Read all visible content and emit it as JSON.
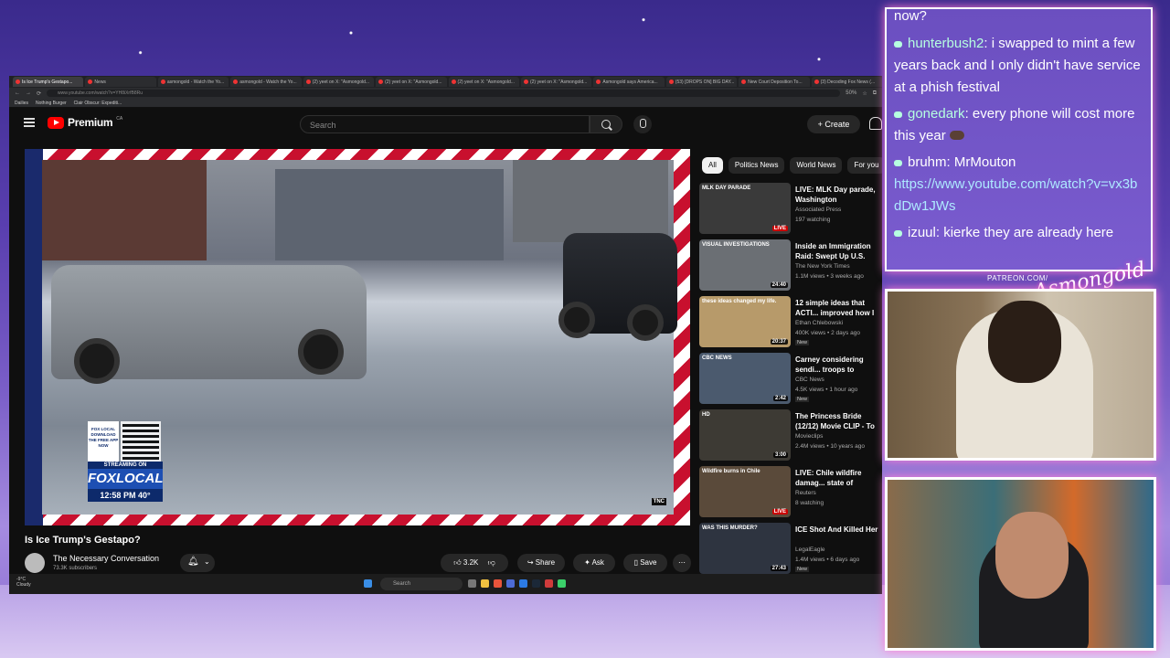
{
  "browser": {
    "tabs": [
      {
        "label": "Is Ice Trump's Gestapo...",
        "active": true
      },
      {
        "label": "News",
        "active": false
      },
      {
        "label": "asmongold - Watch the Yo...",
        "active": false
      },
      {
        "label": "asmongold - Watch the Yo...",
        "active": false
      },
      {
        "label": "(2) yeet on X: \"Asmongold...",
        "active": false
      },
      {
        "label": "(2) yeet on X: \"Asmongold...",
        "active": false
      },
      {
        "label": "(2) yeet on X: \"Asmongold...",
        "active": false
      },
      {
        "label": "(2) yeet on X: \"Asmongold...",
        "active": false
      },
      {
        "label": "Asmongold says America...",
        "active": false
      },
      {
        "label": "(53) [DROPS ON] BIG DAY...",
        "active": false
      },
      {
        "label": "New Court Deposition To...",
        "active": false
      },
      {
        "label": "(3) Decoding Fox News (...",
        "active": false
      }
    ],
    "url": "www.youtube.com/watch?v=YH8iXrfB8Ru",
    "zoom": "50%",
    "bookmarks": [
      "Dailies",
      "Nothing Burger",
      "Clair Obscur: Expediti..."
    ]
  },
  "youtube": {
    "logo_text": "Premium",
    "logo_region": "CA",
    "search_placeholder": "Search",
    "create_label": "Create",
    "video": {
      "title": "Is Ice Trump's Gestapo?",
      "channel": "The Necessary Conversation",
      "subscribers": "73.3K subscribers",
      "likes": "3.2K",
      "share_label": "Share",
      "ask_label": "Ask",
      "save_label": "Save",
      "overlay": {
        "fox_top": "FOX LOCAL DOWNLOAD THE FREE APP NOW",
        "streaming": "STREAMING ON",
        "brand": "FOXLOCAL",
        "time_temp": "12:58 PM  40°",
        "watermark": "TNC"
      }
    },
    "chips": [
      "All",
      "Politics News",
      "World News",
      "For you"
    ],
    "recommendations": [
      {
        "title": "LIVE: MLK Day parade, Washington",
        "channel": "Associated Press",
        "meta": "197 watching",
        "badge": "LIVE",
        "thumb_text": "MLK DAY PARADE",
        "thumb_color": "#3a3a3a"
      },
      {
        "title": "Inside an Immigration Raid: Swept Up U.S. Citizens | V...",
        "channel": "The New York Times",
        "meta": "1.1M views • 3 weeks ago",
        "badge": "24:40",
        "thumb_text": "VISUAL INVESTIGATIONS",
        "thumb_color": "#6b6f74"
      },
      {
        "title": "12 simple ideas that ACTI... improved how I cook.",
        "channel": "Ethan Chlebowski",
        "meta": "400K views • 2 days ago",
        "badge": "20:37",
        "thumb_text": "these ideas changed my life.",
        "thumb_color": "#b79a6a",
        "new": "New"
      },
      {
        "title": "Carney considering sendi... troops to Greenland for N...",
        "channel": "CBC News",
        "meta": "4.5K views • 1 hour ago",
        "badge": "2:42",
        "thumb_text": "CBC NEWS",
        "thumb_color": "#4b5a6e",
        "new": "New"
      },
      {
        "title": "The Princess Bride (12/12) Movie CLIP - To the Pain!",
        "channel": "Movieclips",
        "meta": "2.4M views • 10 years ago",
        "badge": "3:00",
        "thumb_text": "HD",
        "thumb_color": "#3d3a34"
      },
      {
        "title": "LIVE: Chile wildfire damag... state of catastrophe is de...",
        "channel": "Reuters",
        "meta": "8 watching",
        "badge": "LIVE",
        "thumb_text": "Wildfire burns in Chile",
        "thumb_color": "#5a4a3a"
      },
      {
        "title": "ICE Shot And Killed Her",
        "channel": "LegalEagle",
        "meta": "1.4M views • 6 days ago",
        "badge": "27:43",
        "thumb_text": "WAS THIS MURDER?",
        "thumb_color": "#2e3440",
        "new": "New"
      }
    ]
  },
  "taskbar": {
    "weather_temp": "-9°C",
    "weather_desc": "Cloudy",
    "search_label": "Search"
  },
  "chat": {
    "top_partial": "now?",
    "messages": [
      {
        "user": "hunterbush2",
        "text": "i swapped to mint a few years back and I only didn't have service at a phish festival"
      },
      {
        "user": "gonedark",
        "text": "every phone will cost more this year"
      },
      {
        "user": "bruhm",
        "text": "MrMouton",
        "link": "https://www.youtube.com/watch?v=vx3bdDw1JWs"
      },
      {
        "user": "izuul",
        "text": "kierke they are already here"
      }
    ]
  },
  "overlay": {
    "patreon": "PATREON.COM/",
    "signature": "Asmongold"
  }
}
